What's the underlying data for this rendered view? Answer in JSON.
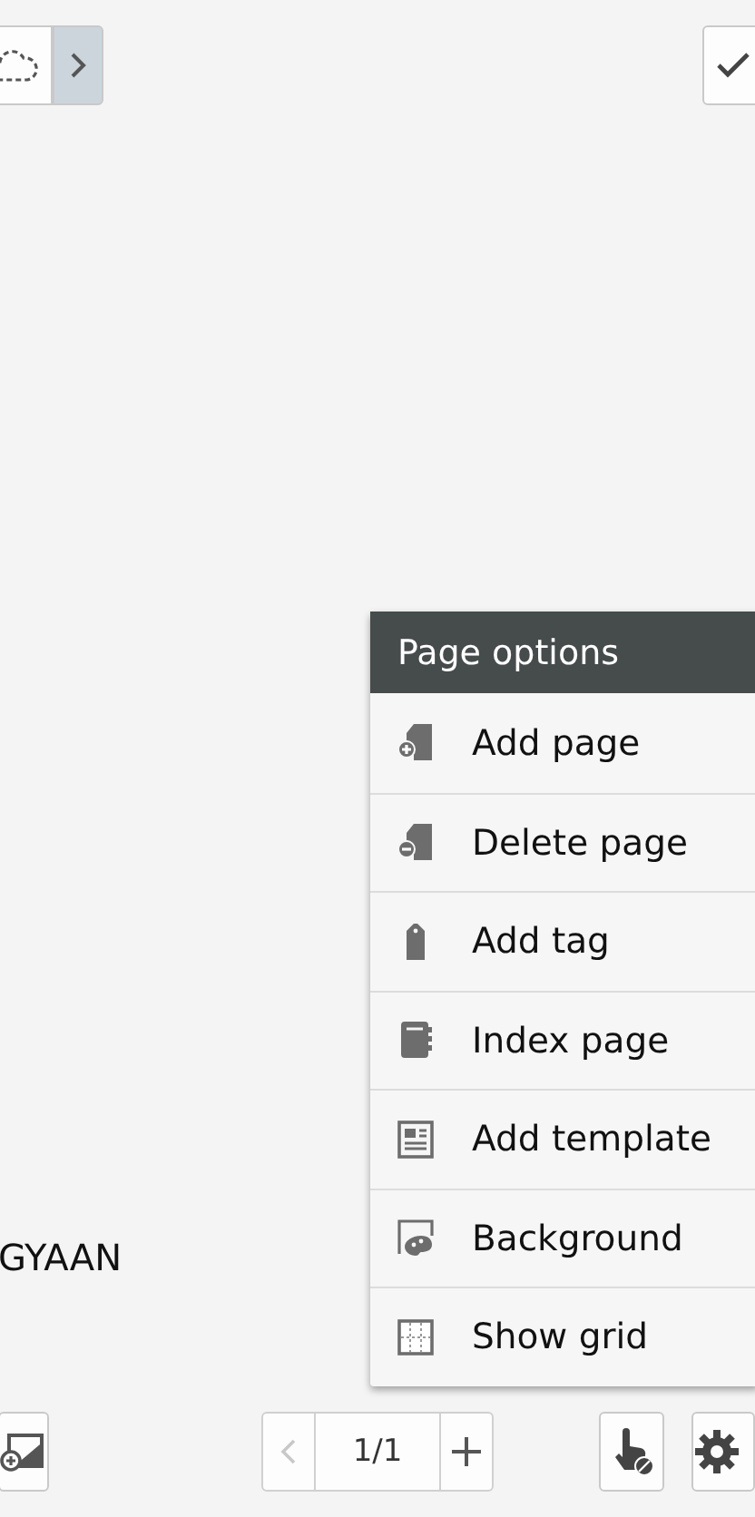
{
  "canvas": {
    "text": "GYAAN"
  },
  "page_options": {
    "title": "Page options",
    "items": [
      {
        "label": "Add page"
      },
      {
        "label": "Delete page"
      },
      {
        "label": "Add tag"
      },
      {
        "label": "Index page"
      },
      {
        "label": "Add template"
      },
      {
        "label": "Background"
      },
      {
        "label": "Show grid"
      }
    ]
  },
  "pager": {
    "page": "1/1",
    "previous_disabled": true
  }
}
